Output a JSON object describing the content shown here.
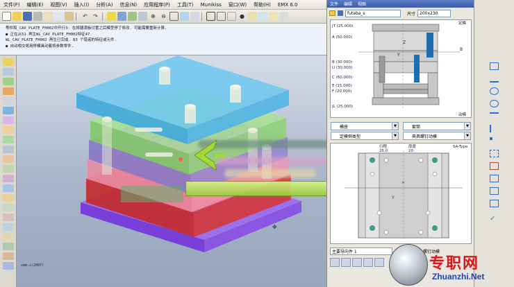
{
  "menubar": {
    "items": [
      "文件(F)",
      "编辑(E)",
      "视图(V)",
      "插入(I)",
      "分析(A)",
      "信息(N)",
      "应用程序(P)",
      "工具(T)",
      "Munikiss",
      "窗口(W)",
      "帮助(H)",
      "EMX 6.0"
    ]
  },
  "messages": [
    "等件和_CAV_PLATE_FH002中开行3: 在将腿源板讨置之后模型停了修改. 可能需要重新计算.",
    "● 正在从51 再生WL_CAV_PLATE_FH002特征47.",
    "WL_CAV_PLATE_FH002 再生已完成. 83 个错诺的特征或元件.",
    "● 自动相交将用移模具动着将参数零件."
  ],
  "viewport": {
    "status": "smm.s(2007)"
  },
  "panel": {
    "title_tabs": [
      "文件",
      "编辑",
      "视图"
    ],
    "vendor": "futaba_s",
    "size_label": "尺寸",
    "size_value": "200x230",
    "diagram1_title": "定模",
    "diagram1_bottom": "动模",
    "plate_labels": [
      "JT (25.000)",
      "A (50.000)",
      "B (30.000)",
      "U (30.000)",
      "C (60.000)",
      "E (15.000)",
      "F (20.000)",
      "JL (25.000)"
    ],
    "marker_z": "Z",
    "marker_b": "B",
    "marker_y": "Y",
    "combo1": "模座",
    "combo2": "套筒",
    "combo3": "定模侧类型",
    "combo4": "夹具螺钉动模",
    "diagram2_cols": [
      "行程",
      "厚度"
    ],
    "diagram2_vals": [
      "25.0",
      "20"
    ],
    "sa_type": "SA-Type",
    "bottom_label": "主要导向件 1",
    "bottom_right": "螺钉动模"
  },
  "watermark": {
    "cn": "专职网",
    "url": "Zhuanzhi.Net"
  },
  "colors": {
    "plate_top": "#4fb8e8",
    "plate_a": "#8cd86a",
    "plate_b": "#9a8fd8",
    "plate_c": "#e88aa0",
    "plate_d": "#d94040",
    "plate_base": "#8e5ae8",
    "accent": "#3c5aa8"
  }
}
